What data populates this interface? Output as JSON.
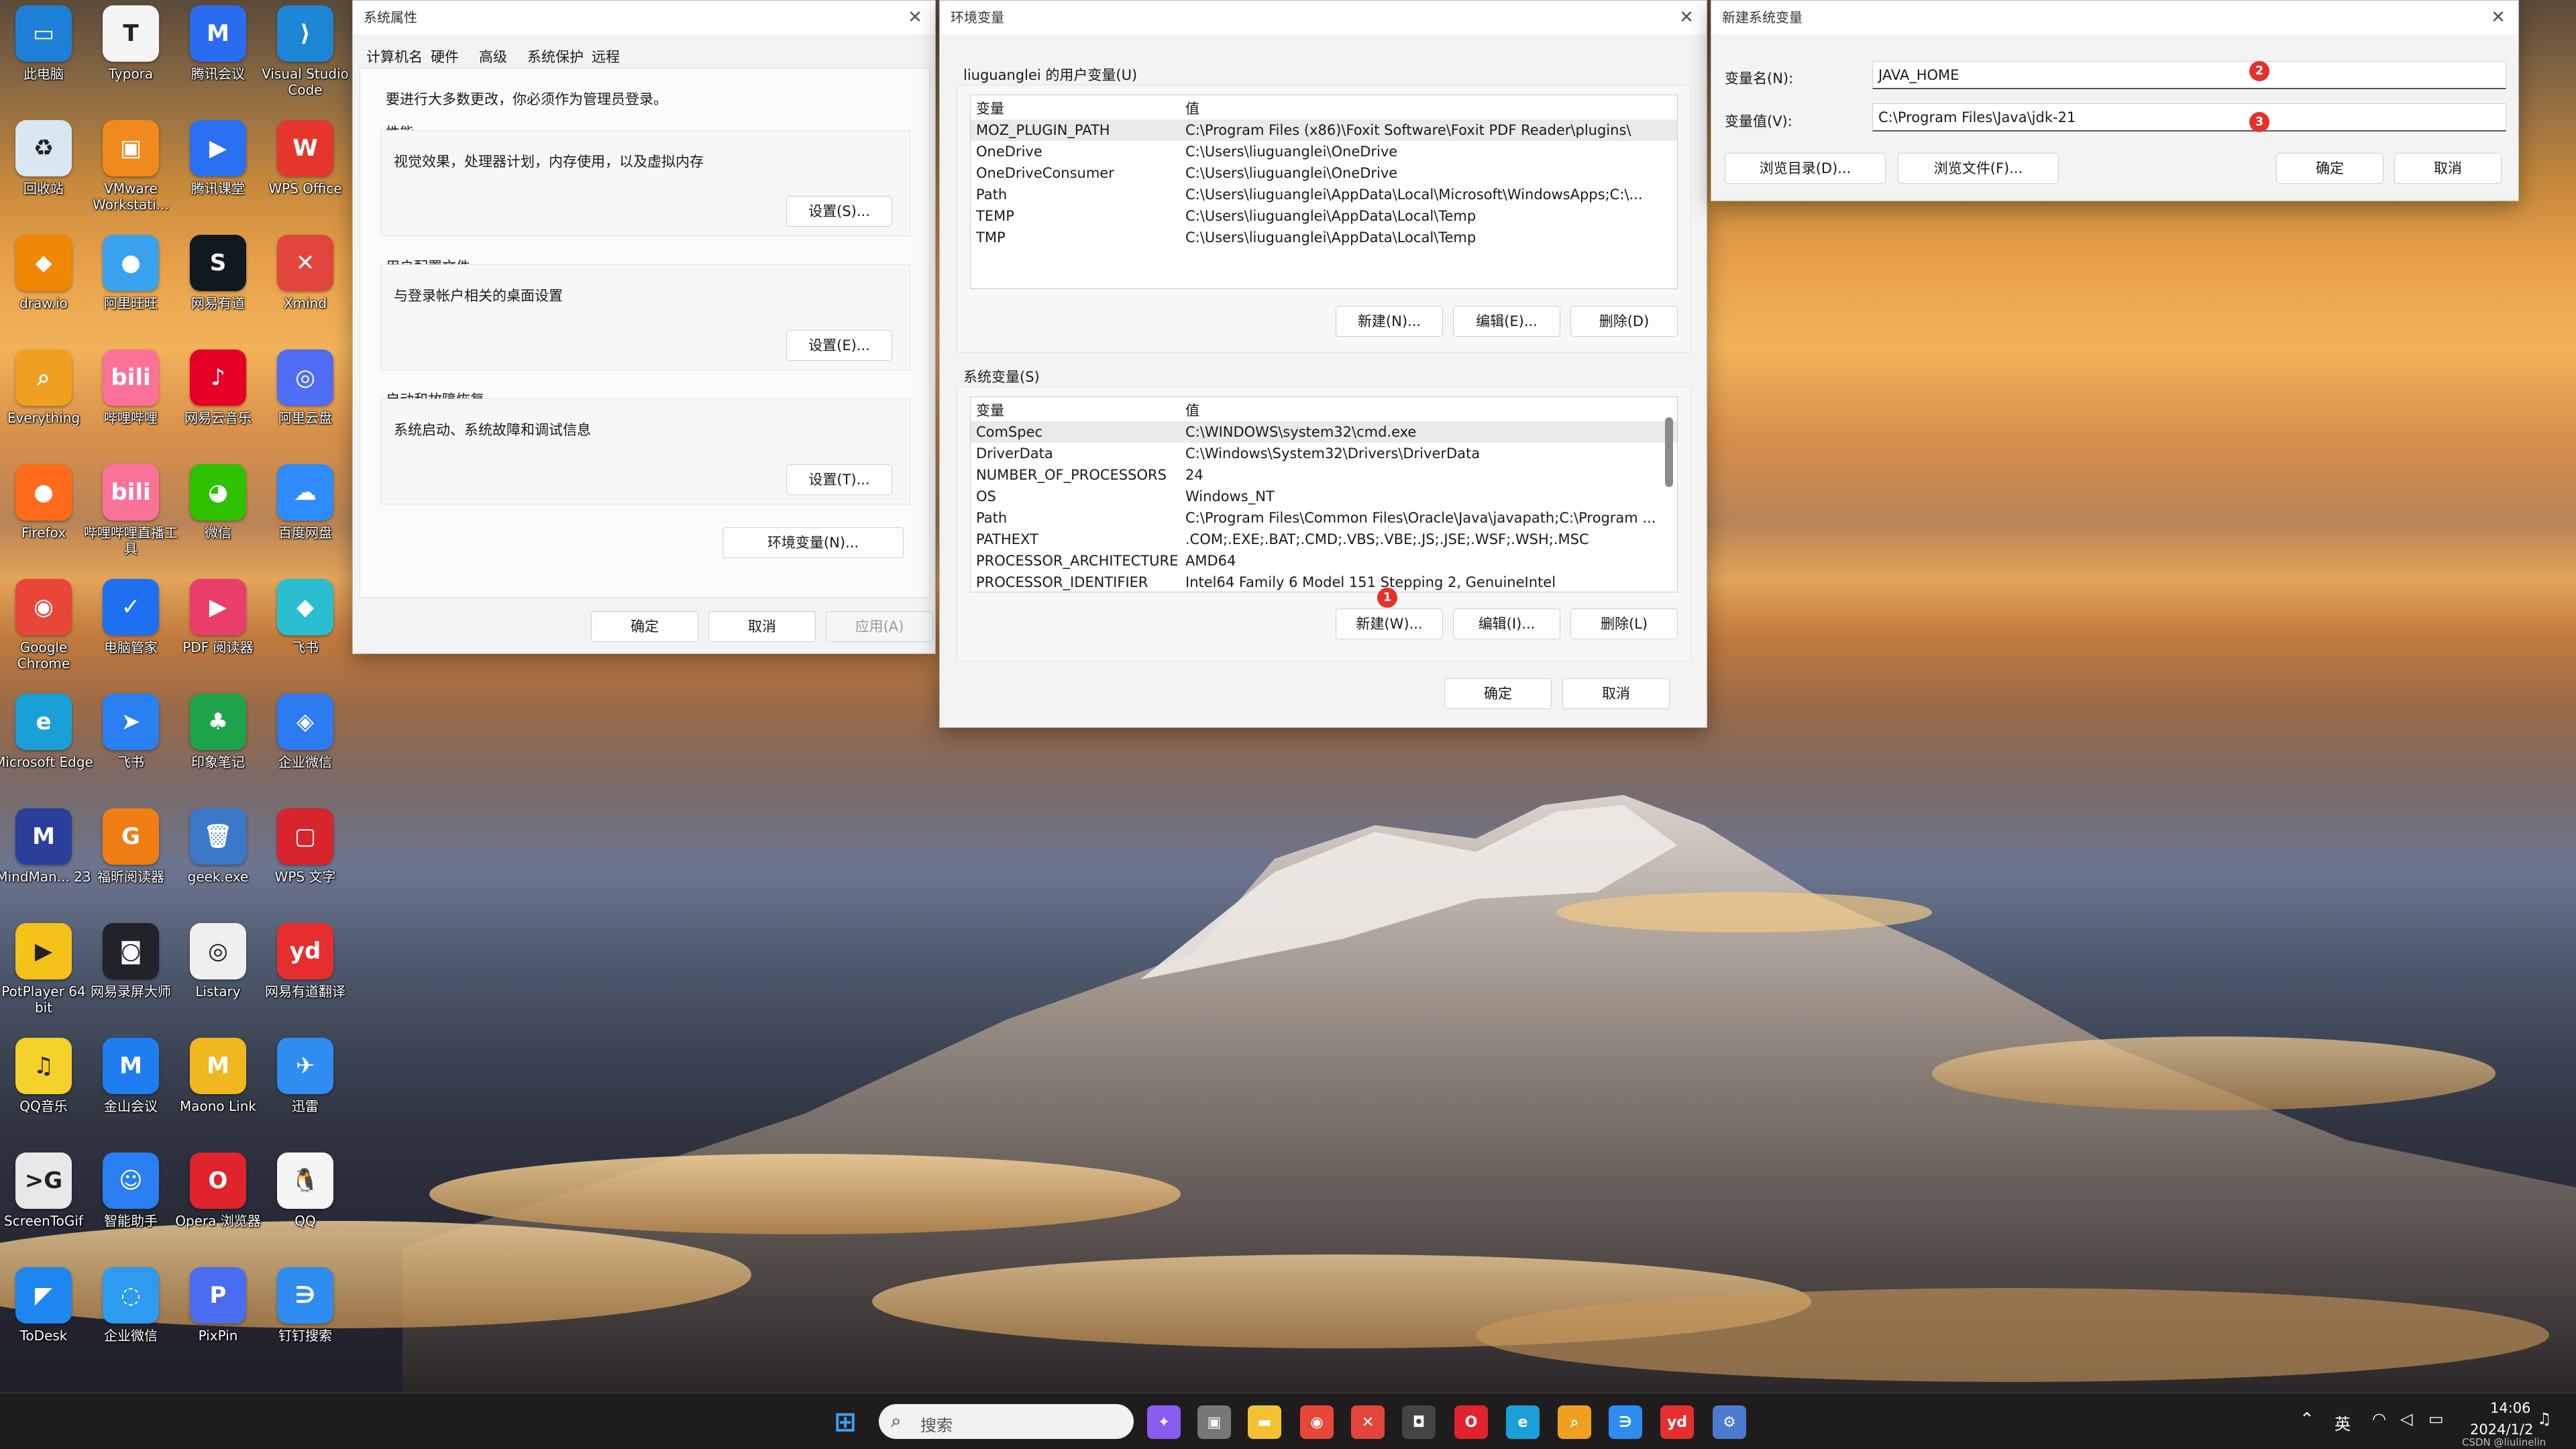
{
  "desktop": {
    "icons": [
      {
        "label": "此电脑",
        "icon": "computer-icon",
        "color": "#1e7fd6",
        "glyph": "▭"
      },
      {
        "label": "Typora",
        "icon": "typora-icon",
        "color": "#f4f4f4",
        "glyph": "T"
      },
      {
        "label": "腾讯会议",
        "icon": "tencent-meeting-icon",
        "color": "#2a6cf0",
        "glyph": "M"
      },
      {
        "label": "Visual Studio Code",
        "icon": "vscode-icon",
        "color": "#1e86d6",
        "glyph": "⟩"
      },
      {
        "label": "回收站",
        "icon": "recycle-bin-icon",
        "color": "#d9e7f3",
        "glyph": "♻"
      },
      {
        "label": "VMware Workstati...",
        "icon": "vmware-icon",
        "color": "#f08a1c",
        "glyph": "▣"
      },
      {
        "label": "腾讯课堂",
        "icon": "tencent-class-icon",
        "color": "#2b6ff2",
        "glyph": "▶"
      },
      {
        "label": "WPS Office",
        "icon": "wps-icon",
        "color": "#e6362c",
        "glyph": "W"
      },
      {
        "label": "draw.io",
        "icon": "drawio-icon",
        "color": "#f08705",
        "glyph": "⬥"
      },
      {
        "label": "阿里旺旺",
        "icon": "aliwangwang-icon",
        "color": "#3aa3f0",
        "glyph": "●"
      },
      {
        "label": "网易有道",
        "icon": "youdao-dict-icon",
        "color": "#101820",
        "glyph": "S"
      },
      {
        "label": "Xmind",
        "icon": "xmind-icon",
        "color": "#e2453b",
        "glyph": "✕"
      },
      {
        "label": "Everything",
        "icon": "everything-icon",
        "color": "#f0a020",
        "glyph": "⌕"
      },
      {
        "label": "哔哩哔哩",
        "icon": "bilibili-icon",
        "color": "#fb7299",
        "glyph": "bili"
      },
      {
        "label": "网易云音乐",
        "icon": "netease-music-icon",
        "color": "#e60026",
        "glyph": "♪"
      },
      {
        "label": "阿里云盘",
        "icon": "aliyun-drive-icon",
        "color": "#4f6df5",
        "glyph": "◎"
      },
      {
        "label": "Firefox",
        "icon": "firefox-icon",
        "color": "#ff6b1a",
        "glyph": "●"
      },
      {
        "label": "哔哩哔哩直播工具",
        "icon": "bilibili-live-icon",
        "color": "#fb7299",
        "glyph": "bili"
      },
      {
        "label": "微信",
        "icon": "wechat-icon",
        "color": "#2dc100",
        "glyph": "◕"
      },
      {
        "label": "百度网盘",
        "icon": "baidu-netdisk-icon",
        "color": "#2f8cff",
        "glyph": "☁"
      },
      {
        "label": "Google Chrome",
        "icon": "chrome-icon",
        "color": "#e9463a",
        "glyph": "◉"
      },
      {
        "label": "电脑管家",
        "icon": "pc-manager-icon",
        "color": "#1f6ff2",
        "glyph": "✓"
      },
      {
        "label": "PDF 阅读器",
        "icon": "pdf-reader-icon",
        "color": "#ea3e6a",
        "glyph": "▶"
      },
      {
        "label": "飞书",
        "icon": "feishu-icon",
        "color": "#2abfd0",
        "glyph": "◆"
      },
      {
        "label": "Microsoft Edge",
        "icon": "edge-icon",
        "color": "#1aa0d8",
        "glyph": "e"
      },
      {
        "label": "飞书",
        "icon": "feishu-blue-icon",
        "color": "#2a7ff2",
        "glyph": "➤"
      },
      {
        "label": "印象笔记",
        "icon": "evernote-icon",
        "color": "#1fa34a",
        "glyph": "♣"
      },
      {
        "label": "企业微信",
        "icon": "wecom-icon",
        "color": "#2d7bf0",
        "glyph": "◈"
      },
      {
        "label": "MindMan... 23",
        "icon": "mindmanager-icon",
        "color": "#2a3f9a",
        "glyph": "M"
      },
      {
        "label": "福昕阅读器",
        "icon": "foxit-icon",
        "color": "#f07e14",
        "glyph": "G"
      },
      {
        "label": "geek.exe",
        "icon": "geek-icon",
        "color": "#3a78c8",
        "glyph": "🗑"
      },
      {
        "label": "WPS 文字",
        "icon": "wps-writer-icon",
        "color": "#d8242c",
        "glyph": "▢"
      },
      {
        "label": "PotPlayer 64 bit",
        "icon": "potplayer-icon",
        "color": "#f5c21a",
        "glyph": "▶"
      },
      {
        "label": "网易录屏大师",
        "icon": "screen-recorder-icon",
        "color": "#20232a",
        "glyph": "◙"
      },
      {
        "label": "Listary",
        "icon": "listary-icon",
        "color": "#f0f0f0",
        "glyph": "◎"
      },
      {
        "label": "网易有道翻译",
        "icon": "youdao-translate-icon",
        "color": "#e62e2e",
        "glyph": "yd"
      },
      {
        "label": "QQ音乐",
        "icon": "qq-music-icon",
        "color": "#f4d12b",
        "glyph": "♫"
      },
      {
        "label": "金山会议",
        "icon": "kingsoft-meeting-icon",
        "color": "#1e7ef0",
        "glyph": "M"
      },
      {
        "label": "Maono Link",
        "icon": "maono-link-icon",
        "color": "#f0b81e",
        "glyph": "M"
      },
      {
        "label": "迅雷",
        "icon": "xunlei-icon",
        "color": "#2f8cf0",
        "glyph": "✈"
      },
      {
        "label": "ScreenToGif",
        "icon": "screentogif-icon",
        "color": "#e8e8e8",
        "glyph": ">G"
      },
      {
        "label": "智能助手",
        "icon": "assistant-icon",
        "color": "#2a7ff2",
        "glyph": "☺"
      },
      {
        "label": "Opera 浏览器",
        "icon": "opera-icon",
        "color": "#e0232d",
        "glyph": "O"
      },
      {
        "label": "QQ",
        "icon": "qq-icon",
        "color": "#f5f5f5",
        "glyph": "🐧"
      },
      {
        "label": "ToDesk",
        "icon": "todesk-icon",
        "color": "#1e86f0",
        "glyph": "◤"
      },
      {
        "label": "企业微信",
        "icon": "wecom-2-icon",
        "color": "#2d9bf0",
        "glyph": "◌"
      },
      {
        "label": "PixPin",
        "icon": "pixpin-icon",
        "color": "#4a6cf0",
        "glyph": "P"
      },
      {
        "label": "钉钉搜索",
        "icon": "dingtalk-icon",
        "color": "#2f8cf0",
        "glyph": "∋"
      }
    ]
  },
  "sysprops": {
    "title": "系统属性",
    "tabs": [
      "计算机名",
      "硬件",
      "高级",
      "系统保护",
      "远程"
    ],
    "admin_note": "要进行大多数更改，你必须作为管理员登录。",
    "perf_title": "性能",
    "perf_desc": "视觉效果，处理器计划，内存使用，以及虚拟内存",
    "perf_btn": "设置(S)...",
    "profile_title": "用户配置文件",
    "profile_desc": "与登录帐户相关的桌面设置",
    "profile_btn": "设置(E)...",
    "startup_title": "启动和故障恢复",
    "startup_desc": "系统启动、系统故障和调试信息",
    "startup_btn": "设置(T)...",
    "env_btn": "环境变量(N)...",
    "ok": "确定",
    "cancel": "取消",
    "apply": "应用(A)"
  },
  "envvars": {
    "title": "环境变量",
    "user_label": "liuguanglei 的用户变量(U)",
    "col_var": "变量",
    "col_val": "值",
    "user_rows": [
      {
        "name": "MOZ_PLUGIN_PATH",
        "value": "C:\\Program Files (x86)\\Foxit Software\\Foxit PDF Reader\\plugins\\"
      },
      {
        "name": "OneDrive",
        "value": "C:\\Users\\liuguanglei\\OneDrive"
      },
      {
        "name": "OneDriveConsumer",
        "value": "C:\\Users\\liuguanglei\\OneDrive"
      },
      {
        "name": "Path",
        "value": "C:\\Users\\liuguanglei\\AppData\\Local\\Microsoft\\WindowsApps;C:\\..."
      },
      {
        "name": "TEMP",
        "value": "C:\\Users\\liuguanglei\\AppData\\Local\\Temp"
      },
      {
        "name": "TMP",
        "value": "C:\\Users\\liuguanglei\\AppData\\Local\\Temp"
      }
    ],
    "user_new": "新建(N)...",
    "user_edit": "编辑(E)...",
    "user_delete": "删除(D)",
    "sys_label": "系统变量(S)",
    "sys_rows": [
      {
        "name": "ComSpec",
        "value": "C:\\WINDOWS\\system32\\cmd.exe"
      },
      {
        "name": "DriverData",
        "value": "C:\\Windows\\System32\\Drivers\\DriverData"
      },
      {
        "name": "NUMBER_OF_PROCESSORS",
        "value": "24"
      },
      {
        "name": "OS",
        "value": "Windows_NT"
      },
      {
        "name": "Path",
        "value": "C:\\Program Files\\Common Files\\Oracle\\Java\\javapath;C:\\Program ..."
      },
      {
        "name": "PATHEXT",
        "value": ".COM;.EXE;.BAT;.CMD;.VBS;.VBE;.JS;.JSE;.WSF;.WSH;.MSC"
      },
      {
        "name": "PROCESSOR_ARCHITECTURE",
        "value": "AMD64"
      },
      {
        "name": "PROCESSOR_IDENTIFIER",
        "value": "Intel64 Family 6 Model 151 Stepping 2, GenuineIntel"
      }
    ],
    "sys_new": "新建(W)...",
    "sys_edit": "编辑(I)...",
    "sys_delete": "删除(L)",
    "ok": "确定",
    "cancel": "取消",
    "badge1": "1"
  },
  "newvar": {
    "title": "新建系统变量",
    "name_label": "变量名(N):",
    "name_value": "JAVA_HOME",
    "value_label": "变量值(V):",
    "value_value": "C:\\Program Files\\Java\\jdk-21",
    "browse_dir": "浏览目录(D)...",
    "browse_file": "浏览文件(F)...",
    "ok": "确定",
    "cancel": "取消",
    "badge2": "2",
    "badge3": "3"
  },
  "taskbar": {
    "search_placeholder": "搜索",
    "apps": [
      {
        "icon": "start-icon",
        "color": "#3aa0f0",
        "glyph": "⊞"
      },
      {
        "icon": "search-icon",
        "color": "#3a3a3a",
        "glyph": "⌕"
      },
      {
        "icon": "copilot-icon",
        "color": "#8a5cf0",
        "glyph": "✦"
      },
      {
        "icon": "task-view-icon",
        "color": "#777",
        "glyph": "▣"
      },
      {
        "icon": "file-explorer-icon",
        "color": "#f2c230",
        "glyph": "▬"
      },
      {
        "icon": "chrome-icon",
        "color": "#e9463a",
        "glyph": "◉"
      },
      {
        "icon": "xmind-icon",
        "color": "#e2453b",
        "glyph": "✕"
      },
      {
        "icon": "camera-icon",
        "color": "#444",
        "glyph": "◘"
      },
      {
        "icon": "opera-icon",
        "color": "#e0232d",
        "glyph": "O"
      },
      {
        "icon": "edge-icon",
        "color": "#1aa0d8",
        "glyph": "e"
      },
      {
        "icon": "everything-icon",
        "color": "#f0a020",
        "glyph": "⌕"
      },
      {
        "icon": "dingtalk-icon",
        "color": "#2f8cf0",
        "glyph": "∋"
      },
      {
        "icon": "youdao-icon",
        "color": "#e62e2e",
        "glyph": "yd"
      },
      {
        "icon": "system-properties-icon",
        "color": "#4a7bd0",
        "glyph": "⚙"
      }
    ],
    "ime": "英",
    "time": "14:06",
    "date": "2024/1/2",
    "watermark": "CSDN @liulinelin"
  }
}
